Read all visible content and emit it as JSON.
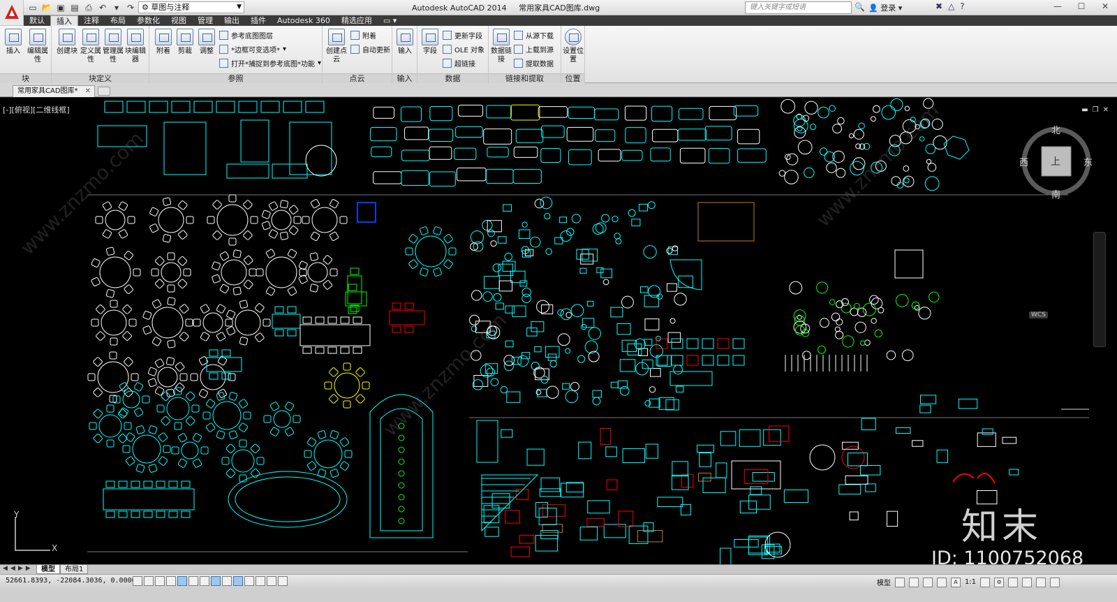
{
  "app": {
    "title": "Autodesk AutoCAD 2014",
    "document": "常用家具CAD图库.dwg",
    "workspace": "草图与注释"
  },
  "search": {
    "placeholder": "键入关键字或短语",
    "login": "登录"
  },
  "menu_tabs": [
    "默认",
    "插入",
    "注释",
    "布局",
    "参数化",
    "视图",
    "管理",
    "输出",
    "插件",
    "Autodesk 360",
    "精选应用"
  ],
  "active_tab": "插入",
  "ribbon": {
    "block_panel": {
      "label": "块",
      "insert": "插入",
      "edit_attr": "编辑属性"
    },
    "block_def_panel": {
      "label": "块定义",
      "create_block": "创建块",
      "define_attr": "定义属性",
      "manage_attr": "管理属性",
      "block_editor": "块编辑器"
    },
    "reference_panel": {
      "label": "参照",
      "attach": "附着",
      "clip": "剪裁",
      "adjust": "调整",
      "underlay_layers": "参考底图图层",
      "frame_var": "*边框可变选项*",
      "snap_underlay": "打开*捕捉到参考底图*功能"
    },
    "pointcloud_panel": {
      "label": "点云",
      "create": "创建点云",
      "attach": "附着",
      "auto_update": "自动更新"
    },
    "import_panel": {
      "label": "输入",
      "import": "输入"
    },
    "data_panel": {
      "label": "数据",
      "field": "字段",
      "update_fields": "更新字段",
      "ole": "OLE 对象",
      "hyperlink": "超链接"
    },
    "link_panel": {
      "label": "链接和提取",
      "data_link": "数据链接",
      "download_source": "从源下载",
      "upload_source": "上载到源",
      "extract": "提取数据"
    },
    "location_panel": {
      "label": "位置",
      "set_location": "设置位置"
    }
  },
  "doc_tab": {
    "name": "常用家具CAD图库*"
  },
  "viewport": {
    "label": "[-][俯视][二维线框]",
    "compass": {
      "north": "北",
      "south": "南",
      "east": "东",
      "west": "西",
      "top": "上"
    },
    "wcs": "WCS",
    "ucs_x": "X",
    "ucs_y": "Y"
  },
  "watermark": {
    "logo": "知末",
    "id": "ID: 1100752068",
    "site": "www.znzmo.com"
  },
  "layout_tabs": [
    "模型",
    "布局1"
  ],
  "status": {
    "coords": "52661.8393, -22084.3036, 0.0000",
    "model": "模型",
    "scale": "1:1"
  },
  "colors": {
    "canvas": "#000000",
    "cyan": "#00ffff",
    "white": "#ffffff",
    "green": "#00ff00",
    "red": "#ff0000",
    "yellow": "#ffff00",
    "blue": "#0040ff",
    "brown": "#c87833"
  }
}
